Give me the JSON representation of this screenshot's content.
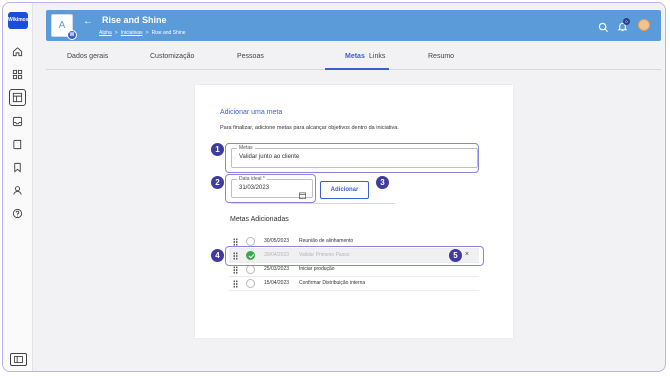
{
  "app": {
    "logo_text": "Wikimos"
  },
  "header": {
    "avatar_letter": "A",
    "badge_letter": "W",
    "title": "Rise and Shine",
    "breadcrumb": [
      "Alpha",
      "Iniciativas",
      "Rise and Shine"
    ],
    "breadcrumb_sep": ">",
    "notification_count": "0"
  },
  "tabs": [
    {
      "label": "Dados gerais"
    },
    {
      "label": "Customização"
    },
    {
      "label": "Pessoas"
    },
    {
      "label": "Metas",
      "active": true
    },
    {
      "label": "Links"
    },
    {
      "label": "Resumo"
    }
  ],
  "form": {
    "title": "Adicionar uma meta",
    "description": "Para finalizar, adicione metas para alcançar objetivos dentro da iniciativa.",
    "meta_label": "Metas",
    "meta_value": "Validar junto ao cliente",
    "date_label": "Data ideal *",
    "date_value": "31/03/2023",
    "add_button": "Adicionar",
    "section_title": "Metas Adicionadas"
  },
  "goals": [
    {
      "date": "30/05/2023",
      "text": "Reunião de alinhamento",
      "done": false
    },
    {
      "date": "30/04/2023",
      "text": "Validar Primeiro Passo",
      "done": true
    },
    {
      "date": "25/03/2023",
      "text": "Iniciar produção",
      "done": false
    },
    {
      "date": "15/04/2023",
      "text": "Confirmar Distribuição interna",
      "done": false
    }
  ],
  "annotations": [
    "1",
    "2",
    "3",
    "4",
    "5"
  ],
  "colors": {
    "accent": "#3b5fd1",
    "header": "#5b9bd9",
    "marker": "#3f3c9d",
    "highlight": "#8a86e0",
    "done": "#3aa64a"
  }
}
